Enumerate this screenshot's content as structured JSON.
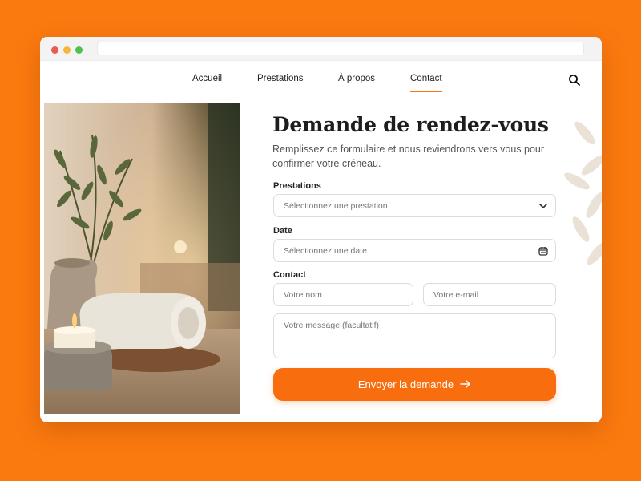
{
  "nav": {
    "items": [
      {
        "label": "Accueil",
        "active": false
      },
      {
        "label": "Prestations",
        "active": false
      },
      {
        "label": "À propos",
        "active": false
      },
      {
        "label": "Contact",
        "active": true
      }
    ],
    "search_icon": "search-icon"
  },
  "form": {
    "title": "Demande de rendez-vous",
    "subtitle": "Remplissez ce formulaire et nous reviendrons vers vous pour confirmer votre créneau.",
    "prestations_label": "Prestations",
    "prestations_placeholder": "Sélectionnez une prestation",
    "date_label": "Date",
    "date_placeholder": "Sélectionnez une date",
    "contact_label": "Contact",
    "name_placeholder": "Votre nom",
    "email_placeholder": "Votre e-mail",
    "message_placeholder": "Votre message (facultatif)",
    "submit_label": "Envoyer la demande"
  },
  "colors": {
    "background": "#fb7a0f",
    "accent": "#f86d0d",
    "nav_underline": "#f57514"
  }
}
